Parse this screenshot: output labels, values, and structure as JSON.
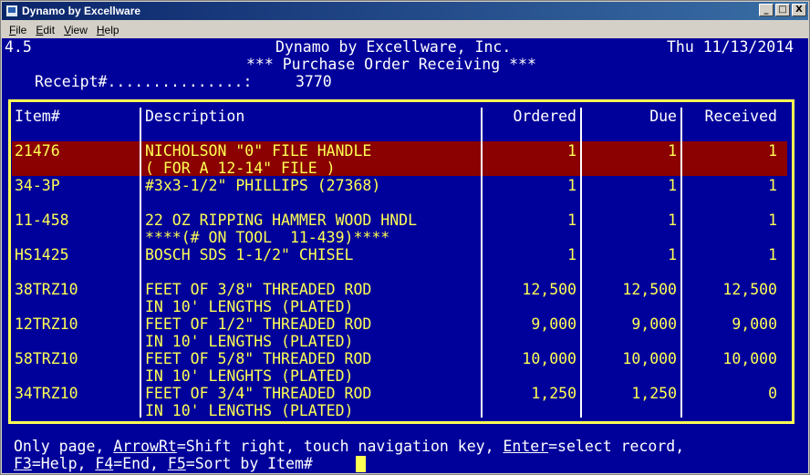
{
  "window": {
    "title": "Dynamo by Excellware",
    "minimize_label": "_",
    "maximize_label": "□",
    "close_label": "X"
  },
  "menu": [
    "File",
    "Edit",
    "View",
    "Help"
  ],
  "header": {
    "version": "4.5",
    "company": "Dynamo by Excellware, Inc.",
    "date": "Thu 11/13/2014",
    "screen_title": "*** Purchase Order Receiving ***",
    "receipt_label": "Receipt#...............:",
    "receipt_value": "3770"
  },
  "columns": {
    "item": "Item#",
    "description": "Description",
    "ordered": "Ordered",
    "due": "Due",
    "received": "Received"
  },
  "rows": [
    {
      "item": "21476",
      "desc1": "NICHOLSON \"0\" FILE HANDLE",
      "desc2": "( FOR A 12-14\" FILE )",
      "ordered": "1",
      "due": "1",
      "received": "1"
    },
    {
      "item": "34-3P",
      "desc1": "#3x3-1/2\" PHILLIPS (27368)",
      "desc2": "",
      "ordered": "1",
      "due": "1",
      "received": "1"
    },
    {
      "item": "11-458",
      "desc1": "22 OZ RIPPING HAMMER WOOD HNDL",
      "desc2": "****(# ON TOOL  11-439)****",
      "ordered": "1",
      "due": "1",
      "received": "1"
    },
    {
      "item": "HS1425",
      "desc1": "BOSCH SDS 1-1/2\" CHISEL",
      "desc2": "",
      "ordered": "1",
      "due": "1",
      "received": "1"
    },
    {
      "item": "38TRZ10",
      "desc1": "FEET OF 3/8\" THREADED ROD",
      "desc2": "IN 10' LENGTHS (PLATED)",
      "ordered": "12,500",
      "due": "12,500",
      "received": "12,500"
    },
    {
      "item": "12TRZ10",
      "desc1": "FEET OF 1/2\" THREADED ROD",
      "desc2": "IN 10' LENGTHS (PLATED)",
      "ordered": "9,000",
      "due": "9,000",
      "received": "9,000"
    },
    {
      "item": "58TRZ10",
      "desc1": "FEET OF 5/8\" THREADED ROD",
      "desc2": "IN 10' LENGHTS (PLATED)",
      "ordered": "10,000",
      "due": "10,000",
      "received": "10,000"
    },
    {
      "item": "34TRZ10",
      "desc1": "FEET OF 3/4\" THREADED ROD",
      "desc2": "IN 10' LENGTHS (PLATED)",
      "ordered": "1,250",
      "due": "1,250",
      "received": "0"
    }
  ],
  "status": {
    "line1_a": "Only page, ",
    "key_arrow": "ArrowRt",
    "line1_b": "=Shift right, touch navigation key, ",
    "key_enter": "Enter",
    "line1_c": "=select record,",
    "key_f3": "F3",
    "line2_a": "=Help, ",
    "key_f4": "F4",
    "line2_b": "=End, ",
    "key_f5": "F5",
    "line2_c": "=Sort by Item#"
  },
  "colors": {
    "console_bg": "#00009a",
    "text_yellow": "#ffff54",
    "highlight_row": "#8b0000",
    "titlebar": "#0a246a"
  }
}
